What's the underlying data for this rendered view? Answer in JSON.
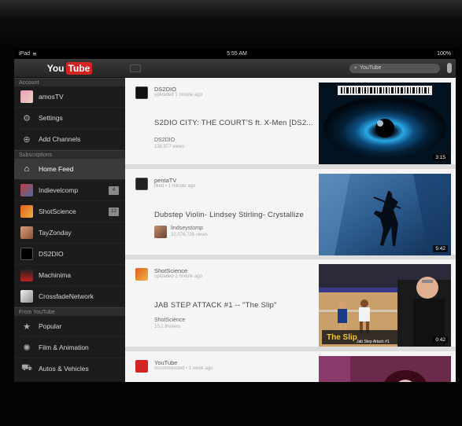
{
  "status_bar": {
    "carrier": "iPad",
    "time": "5:55 AM",
    "battery": "100%"
  },
  "app": {
    "logo_you": "You",
    "logo_tube": "Tube"
  },
  "sidebar": {
    "account_header": "Account",
    "account_items": [
      {
        "label": "amosTV",
        "icon": "avatar-icon"
      },
      {
        "label": "Settings",
        "icon": "gear-icon"
      },
      {
        "label": "Add Channels",
        "icon": "add-icon"
      }
    ],
    "subscriptions_header": "Subscriptions",
    "subscription_items": [
      {
        "label": "Home Feed",
        "icon": "home-icon",
        "active": true
      },
      {
        "label": "Indievelcomp",
        "badge": "4"
      },
      {
        "label": "ShotScience",
        "badge": "12"
      },
      {
        "label": "TayZonday"
      },
      {
        "label": "DS2DIO"
      },
      {
        "label": "Machinima"
      },
      {
        "label": "CrossfadeNetwork"
      }
    ],
    "from_youtube_header": "From YouTube",
    "youtube_items": [
      {
        "label": "Popular",
        "icon": "star-icon"
      },
      {
        "label": "Film & Animation",
        "icon": "film-icon"
      },
      {
        "label": "Autos & Vehicles",
        "icon": "car-icon"
      }
    ]
  },
  "topbar": {
    "search_placeholder": "YouTube"
  },
  "feed": [
    {
      "channel": "DS2DIO",
      "meta": "uploaded 1 minute ago",
      "title": "S2DIO CITY: THE COURT'S ft. X-Men [DS2...",
      "sub_channel": "DS2DIO",
      "views": "138,977 views",
      "duration": "3:15"
    },
    {
      "channel": "pentaTV",
      "meta": "liked • 1 minute ago",
      "title": "Dubstep Violin- Lindsey Stirling- Crystallize",
      "sub_channel": "lindseystomp",
      "views": "32,076,726 views",
      "duration": "5:42"
    },
    {
      "channel": "ShotScience",
      "meta": "uploaded 1 minute ago",
      "title": "JAB STEP ATTACK #1 -- \"The Slip\"",
      "sub_channel": "ShotScience",
      "views": "10.1 thviews",
      "duration": "0:42",
      "thumb_text": "The Slip",
      "thumb_subtext": "Jab Step Attack #1"
    },
    {
      "channel": "YouTube",
      "meta": "recommended • 1 week ago"
    }
  ]
}
